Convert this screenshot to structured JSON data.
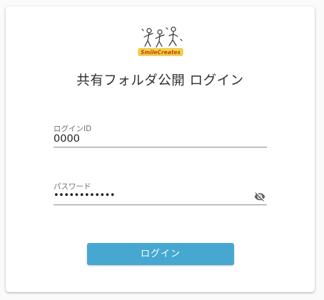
{
  "header": {
    "logo_text": "SmileCreates",
    "title": "共有フォルダ公開 ログイン"
  },
  "form": {
    "login_id": {
      "label": "ログインID",
      "value": "0000"
    },
    "password": {
      "label": "パスワード",
      "value": "••••••••••••",
      "visibility_icon": "eye-off-icon"
    },
    "submit_label": "ログイン"
  },
  "colors": {
    "button": "#46a8d1",
    "logo_text": "#e8c21a",
    "background": "#fafafa",
    "card": "#ffffff"
  }
}
